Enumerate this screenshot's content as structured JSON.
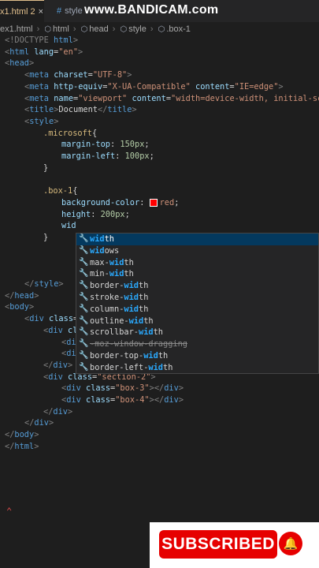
{
  "tabs": [
    {
      "label": "x1.html",
      "badge": "2",
      "close": "×"
    },
    {
      "label": "style"
    }
  ],
  "watermark": "www.BANDICAM.com",
  "breadcrumb": [
    "ex1.html",
    "html",
    "head",
    "style",
    ".box-1"
  ],
  "code": {
    "l1": [
      "<!DOCTYPE ",
      "html",
      ">"
    ],
    "l2": [
      "<",
      "html",
      " ",
      "lang",
      "=",
      "\"en\"",
      ">"
    ],
    "l3": [
      "<",
      "head",
      ">"
    ],
    "l4": [
      "<",
      "meta",
      " ",
      "charset",
      "=",
      "\"UTF-8\"",
      ">"
    ],
    "l5": [
      "<",
      "meta",
      " ",
      "http-equiv",
      "=",
      "\"X-UA-Compatible\"",
      " ",
      "content",
      "=",
      "\"IE=edge\"",
      ">"
    ],
    "l6": [
      "<",
      "meta",
      " ",
      "name",
      "=",
      "\"viewport\"",
      " ",
      "content",
      "=",
      "\"width=device-width, initial-scal"
    ],
    "l7": [
      "<",
      "title",
      ">",
      "Document",
      "</",
      "title",
      ">"
    ],
    "l8": [
      "<",
      "style",
      ">"
    ],
    "l9": [
      ".microsoft",
      "{"
    ],
    "l10": [
      "margin-top",
      ": ",
      "150px",
      ";"
    ],
    "l11": [
      "margin-left",
      ": ",
      "100px",
      ";"
    ],
    "l12": [
      "}"
    ],
    "l13": [
      ".box-1",
      "{"
    ],
    "l14": [
      "background-color",
      ": ",
      "red",
      ";"
    ],
    "l15": [
      "height",
      ": ",
      "200px",
      ";"
    ],
    "l16": [
      "wid"
    ],
    "l17": [
      "}"
    ],
    "l18": [
      "</",
      "style",
      ">"
    ],
    "l19": [
      "</",
      "head",
      ">"
    ],
    "l20": [
      "<",
      "body",
      ">"
    ],
    "l21": [
      "<",
      "div",
      " ",
      "class",
      "="
    ],
    "l22": [
      "<",
      "div",
      " ",
      "cl"
    ],
    "l23": [
      "<",
      "di"
    ],
    "l24": [
      "<",
      "di"
    ],
    "l25": [
      "</",
      "div",
      ">"
    ],
    "l26": [
      "<",
      "div",
      " ",
      "class",
      "=",
      "\"section-2\"",
      ">"
    ],
    "l27": [
      "<",
      "div",
      " ",
      "class",
      "=",
      "\"box-3\"",
      "></",
      "div",
      ">"
    ],
    "l28": [
      "<",
      "div",
      " ",
      "class",
      "=",
      "\"box-4\"",
      "></",
      "div",
      ">"
    ],
    "l29": [
      "</",
      "div",
      ">"
    ],
    "l30": [
      "</",
      "div",
      ">"
    ],
    "l31": [
      "</",
      "body",
      ">"
    ],
    "l32": [
      "</",
      "html",
      ">"
    ]
  },
  "suggestions": [
    {
      "pre": "",
      "hl": "wid",
      "post": "th"
    },
    {
      "pre": "",
      "hl": "wid",
      "post": "ows"
    },
    {
      "pre": "max-",
      "hl": "wid",
      "post": "th"
    },
    {
      "pre": "min-",
      "hl": "wid",
      "post": "th"
    },
    {
      "pre": "border-",
      "hl": "wid",
      "post": "th"
    },
    {
      "pre": "stroke-",
      "hl": "wid",
      "post": "th"
    },
    {
      "pre": "column-",
      "hl": "wid",
      "post": "th"
    },
    {
      "pre": "outline-",
      "hl": "wid",
      "post": "th"
    },
    {
      "pre": "scrollbar-",
      "hl": "wid",
      "post": "th"
    },
    {
      "pre": "-moz-window-dragging",
      "hl": "",
      "post": ""
    },
    {
      "pre": "border-top-",
      "hl": "wid",
      "post": "th"
    },
    {
      "pre": "border-left-",
      "hl": "wid",
      "post": "th"
    }
  ],
  "subscribe": {
    "label": "SUBSCRIBED",
    "bell": "🔔"
  },
  "cursor_mark": "⌃"
}
